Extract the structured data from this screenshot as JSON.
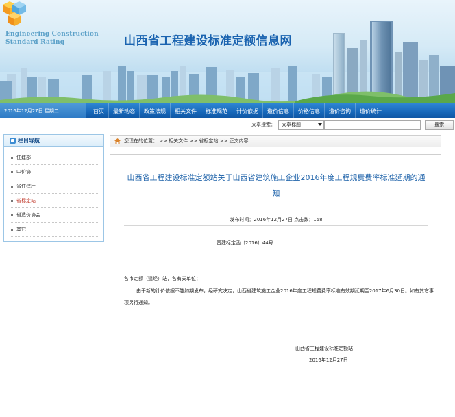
{
  "header": {
    "logo_line1": "Engineering Construction",
    "logo_line2": "Standard Rating",
    "site_title": "山西省工程建设标准定额信息网"
  },
  "nav": {
    "date": "2016年12月27日  星期二",
    "items": [
      "首页",
      "最新动态",
      "政策法规",
      "相关文件",
      "标准规范",
      "计价依据",
      "造价信息",
      "价格信息",
      "造价咨询",
      "造价统计"
    ]
  },
  "search": {
    "label": "文章搜索：",
    "select_value": "文章标题",
    "button_label": "搜索"
  },
  "sidebar": {
    "title": "栏目导航",
    "items": [
      "住建部",
      "中价协",
      "省住建厅",
      "省标定站",
      "省造价协会",
      "其它"
    ]
  },
  "breadcrumb": {
    "text": "您现在的位置： >> 相关文件 >> 省标定站 >> 正文内容"
  },
  "article": {
    "title": "山西省工程建设标准定额站关于山西省建筑施工企业2016年度工程规费费率标准延期的通知",
    "meta": "发布时间：2016年12月27日    点击数：158",
    "doc_number": "晋建标定函〔2016〕44号",
    "salutation": "各市定额（建经）站，各有关单位：",
    "body": "由于新的计价依据不能如期发布，经研究决定，山西省建筑施工企业2016年度工程规费费率标准有效期延期至2017年6月30日。如有其它事项另行通知。",
    "sign_org": "山西省工程建设标准定额站",
    "sign_date": "2016年12月27日"
  },
  "colors": {
    "nav_blue": "#1666b8",
    "title_blue": "#1f63aa",
    "active_red": "#c0392b"
  }
}
